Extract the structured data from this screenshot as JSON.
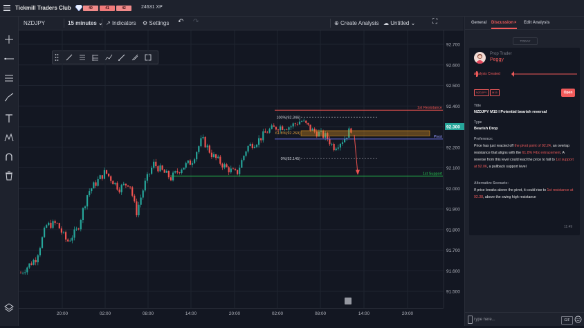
{
  "header": {
    "club_name": "Tickmill Traders Club",
    "xp_bars": [
      "40",
      "41",
      "42"
    ],
    "xp": "24631 XP"
  },
  "toolbar": {
    "symbol": "NZDJPY",
    "interval": "15 minutes",
    "indicators": "Indicators",
    "settings": "Settings",
    "create_analysis": "Create Analysis",
    "layout_name": "Untitled"
  },
  "chart": {
    "price_ticks": [
      "92.700",
      "92.600",
      "92.500",
      "92.400",
      "92.300",
      "92.200",
      "92.100",
      "92.000",
      "91.900",
      "91.800",
      "91.700",
      "91.600",
      "91.500"
    ],
    "time_ticks": [
      "20:00",
      "02:00",
      "08:00",
      "14:00",
      "20:00",
      "02:00",
      "08:00",
      "14:00",
      "20:00"
    ],
    "current_price": "92.300",
    "current_price_color": "#26a69a",
    "up_color": "#26a69a",
    "down_color": "#ef5350",
    "fib_100": "100%(92.346)",
    "fib_618": "61.8%(92.269)",
    "fib_0": "0%(92.145)",
    "resistance_label": "1st Resistance",
    "pivot_label": "Pivot",
    "support_label": "1st Support"
  },
  "panel": {
    "tabs": [
      "General",
      "Discussion",
      "Edit Analysis"
    ],
    "active_tab": "Discussion",
    "today": "TODAY",
    "author_role": "Prop Trader",
    "author_name": "Peggy",
    "created": "Analysis Created",
    "tags": [
      "NZDJPY",
      "M15"
    ],
    "open_button": "Open",
    "title_label": "Title",
    "title": "NZDJPY M15 I Potential bearish reversal",
    "type_label": "Type",
    "type": "Bearish Drop",
    "preference_label": "Preference:",
    "preference": {
      "p1": "Price has just reacted off ",
      "h1": "the pivot point of 92.24",
      "p2": ", an overlap resistance that aligns with the ",
      "h2": "61.8% Fibo retracement",
      "p3": ". A reverse from this level could lead the price to fall to ",
      "h3": "1st support at 92.06",
      "p4": ", a pullback support level"
    },
    "alt_label": "Alternative Scenario:",
    "alt": {
      "p1": "If price breaks above the pivot, it could rise to ",
      "h1": "1st resistance at 92.38",
      "p2": ", above the swing high resistance"
    },
    "timestamp": "11:49",
    "reply_placeholder": "Type here...",
    "gif": "GIF"
  }
}
